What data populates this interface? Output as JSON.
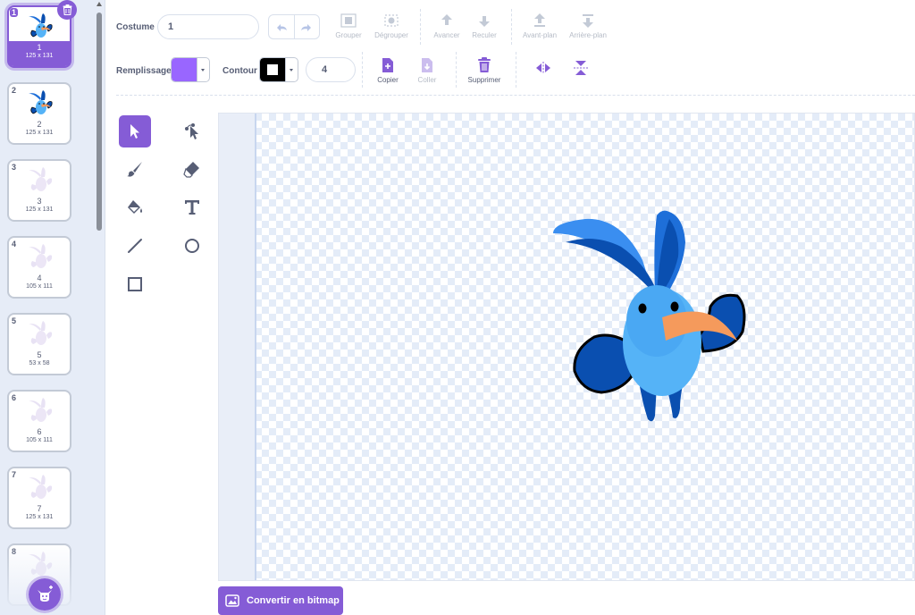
{
  "costumes": [
    {
      "num": "1",
      "name": "1",
      "size": "125 x 131",
      "selected": true,
      "kind": "full"
    },
    {
      "num": "2",
      "name": "2",
      "size": "125 x 131",
      "selected": false,
      "kind": "full"
    },
    {
      "num": "3",
      "name": "3",
      "size": "125 x 131",
      "selected": false,
      "kind": "faded"
    },
    {
      "num": "4",
      "name": "4",
      "size": "105 x 111",
      "selected": false,
      "kind": "faded"
    },
    {
      "num": "5",
      "name": "5",
      "size": "53 x 58",
      "selected": false,
      "kind": "faded"
    },
    {
      "num": "6",
      "name": "6",
      "size": "105 x 111",
      "selected": false,
      "kind": "faded"
    },
    {
      "num": "7",
      "name": "7",
      "size": "125 x 131",
      "selected": false,
      "kind": "faded"
    },
    {
      "num": "8",
      "name": "",
      "size": "",
      "selected": false,
      "kind": "faded"
    }
  ],
  "toolbar": {
    "costume_label": "Costume",
    "costume_name": "1",
    "group": "Grouper",
    "ungroup": "Dégrouper",
    "forward": "Avancer",
    "backward": "Reculer",
    "front": "Avant-plan",
    "back": "Arrière-plan",
    "fill_label": "Remplissage",
    "outline_label": "Contour",
    "outline_width": "4",
    "copy": "Copier",
    "paste": "Coller",
    "delete": "Supprimer"
  },
  "colors": {
    "accent": "#855cd6",
    "fill": "#9966ff",
    "outline": "#000000"
  },
  "tools": [
    "select-tool",
    "reshape-tool",
    "brush-tool",
    "eraser-tool",
    "fill-tool",
    "text-tool",
    "line-tool",
    "circle-tool",
    "rectangle-tool"
  ],
  "convert_button": "Convertir en bitmap"
}
